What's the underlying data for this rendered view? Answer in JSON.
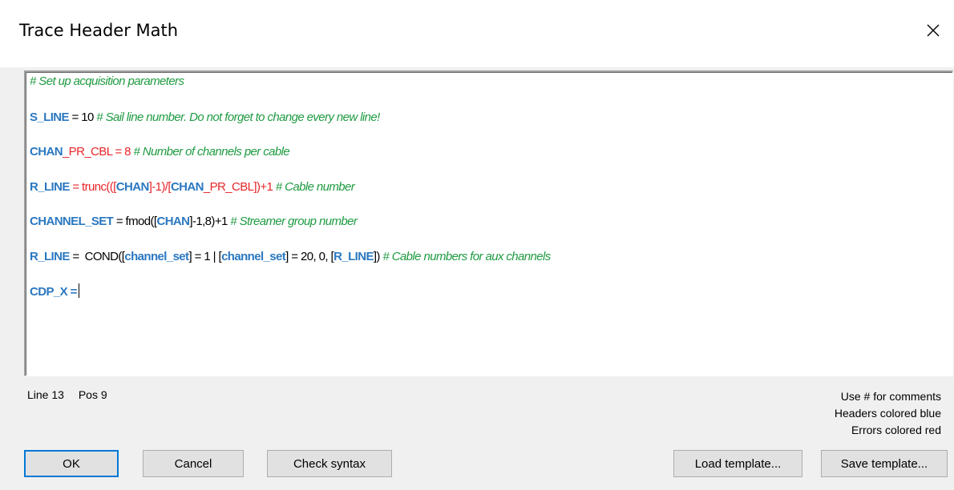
{
  "window": {
    "title": "Trace Header Math"
  },
  "editor": {
    "lines": [
      {
        "segments": [
          {
            "cls": "cmt",
            "text": "# Set up acquisition parameters"
          }
        ]
      },
      {
        "segments": [
          {
            "cls": "hdr",
            "text": "S_LINE"
          },
          {
            "cls": "plain",
            "text": " = 10 "
          },
          {
            "cls": "cmt",
            "text": "# Sail line number. Do not forget to change every new line!"
          }
        ]
      },
      {
        "segments": [
          {
            "cls": "hdr",
            "text": "CHAN"
          },
          {
            "cls": "err",
            "text": "_PR_CBL = 8 "
          },
          {
            "cls": "cmt",
            "text": "# Number of channels per cable"
          }
        ]
      },
      {
        "segments": [
          {
            "cls": "hdr",
            "text": "R_LINE"
          },
          {
            "cls": "err",
            "text": " = trunc((["
          },
          {
            "cls": "hdr",
            "text": "CHAN"
          },
          {
            "cls": "err",
            "text": "]-1)/["
          },
          {
            "cls": "hdr",
            "text": "CHAN"
          },
          {
            "cls": "err",
            "text": "_PR_CBL])+1 "
          },
          {
            "cls": "cmt",
            "text": "# Cable number"
          }
        ]
      },
      {
        "segments": [
          {
            "cls": "hdr",
            "text": "CHANNEL_SET"
          },
          {
            "cls": "plain",
            "text": " = fmod(["
          },
          {
            "cls": "hdr",
            "text": "CHAN"
          },
          {
            "cls": "plain",
            "text": "]-1,8)+1 "
          },
          {
            "cls": "cmt",
            "text": "# Streamer group number"
          }
        ]
      },
      {
        "segments": [
          {
            "cls": "hdr",
            "text": "R_LINE"
          },
          {
            "cls": "plain",
            "text": " =  COND(["
          },
          {
            "cls": "hdr",
            "text": "channel_set"
          },
          {
            "cls": "plain",
            "text": "] = 1 | ["
          },
          {
            "cls": "hdr",
            "text": "channel_set"
          },
          {
            "cls": "plain",
            "text": "] = 20, 0, ["
          },
          {
            "cls": "hdr",
            "text": "R_LINE"
          },
          {
            "cls": "plain",
            "text": "]) "
          },
          {
            "cls": "cmt",
            "text": "# Cable numbers for aux channels"
          }
        ]
      },
      {
        "segments": [
          {
            "cls": "hdr",
            "text": "CDP_X"
          },
          {
            "cls": "hdr",
            "text": " ="
          }
        ],
        "caret": true
      }
    ]
  },
  "status": {
    "line_label": "Line 13",
    "pos_label": "Pos 9"
  },
  "hints": {
    "comments": "Use # for comments",
    "headers": "Headers colored blue",
    "errors": "Errors colored red"
  },
  "buttons": {
    "ok": "OK",
    "cancel": "Cancel",
    "check_syntax": "Check syntax",
    "load_template": "Load template...",
    "save_template": "Save template..."
  },
  "colors": {
    "header": "#2b78c0",
    "comment": "#1f9b42",
    "error": "#e8262a",
    "default_button_border": "#0078d7"
  }
}
